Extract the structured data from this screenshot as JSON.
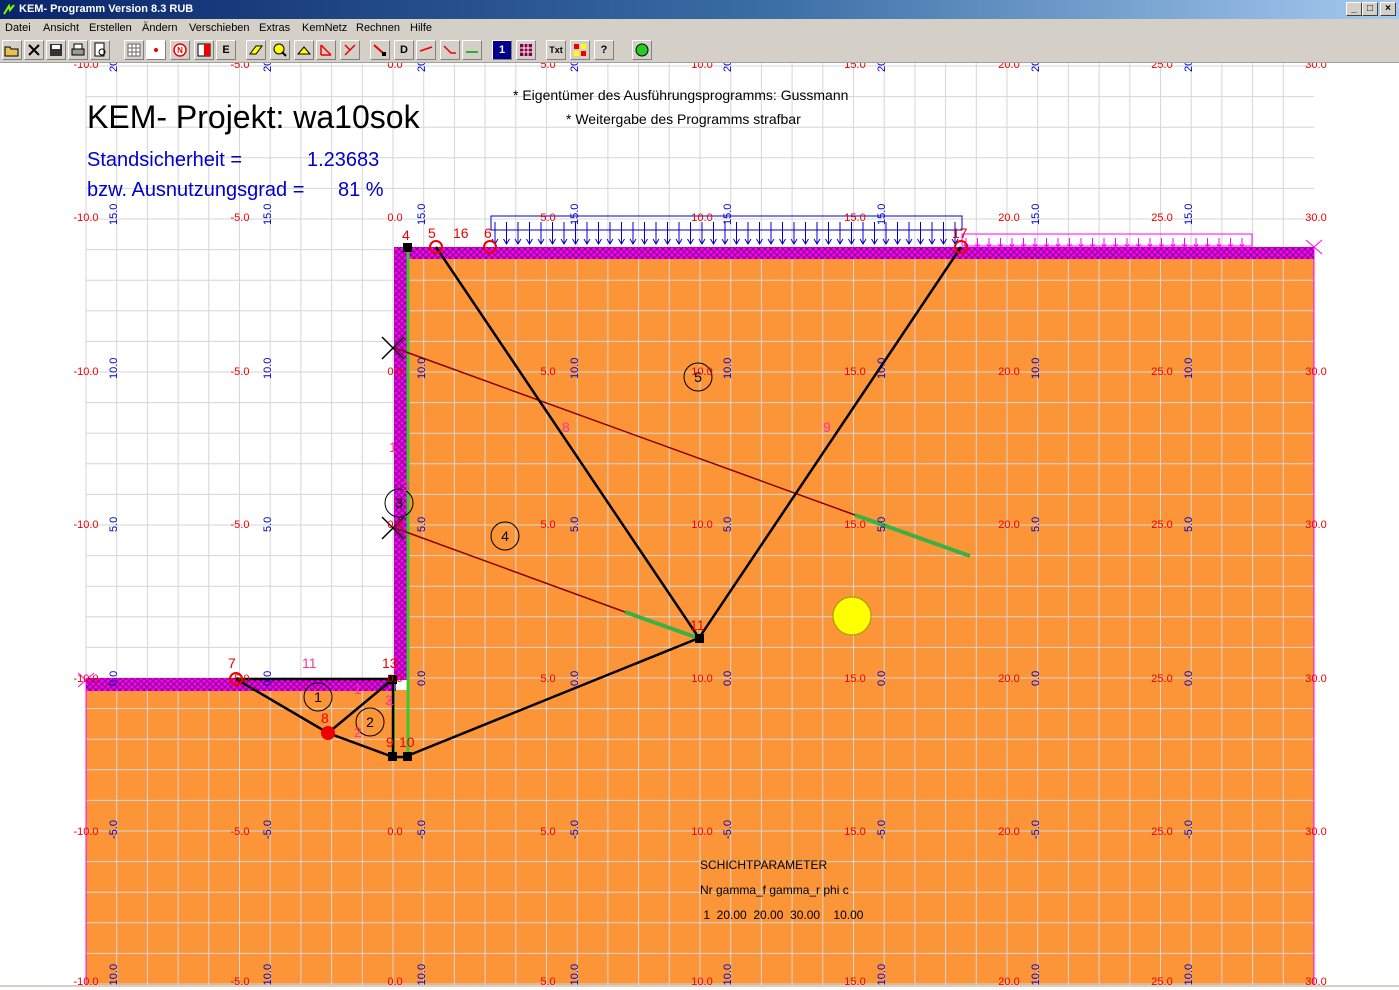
{
  "window": {
    "title": "KEM- Programm Version 8.3 RUB",
    "buttons": {
      "minimize": "_",
      "maximize": "□",
      "close": "×"
    }
  },
  "menu": {
    "items": [
      "Datei",
      "Ansicht",
      "Erstellen",
      "Ändern",
      "Verschieben",
      "Extras",
      "KemNetz",
      "Rechnen",
      "Hilfe"
    ]
  },
  "toolbar": {
    "buttons": [
      {
        "name": "open-icon",
        "label": ""
      },
      {
        "name": "close-file-icon",
        "label": ""
      },
      {
        "name": "save-icon",
        "label": ""
      },
      {
        "name": "print-icon",
        "label": ""
      },
      {
        "name": "print-preview-icon",
        "label": ""
      },
      {
        "name": "grid-icon",
        "label": ""
      },
      {
        "name": "point-icon",
        "label": ""
      },
      {
        "name": "node-icon",
        "label": "N"
      },
      {
        "name": "layer-color-icon",
        "label": ""
      },
      {
        "name": "e-button",
        "label": "E"
      },
      {
        "name": "load-icon",
        "label": ""
      },
      {
        "name": "zoom-icon",
        "label": ""
      },
      {
        "name": "slope-icon",
        "label": ""
      },
      {
        "name": "angle-icon",
        "label": ""
      },
      {
        "name": "diagonal-icon",
        "label": ""
      },
      {
        "name": "arrow-node-icon",
        "label": ""
      },
      {
        "name": "d-node-icon",
        "label": "D"
      },
      {
        "name": "line-icon-1",
        "label": ""
      },
      {
        "name": "line-icon-2",
        "label": ""
      },
      {
        "name": "anchor-icon",
        "label": ""
      },
      {
        "name": "one-icon",
        "label": "1"
      },
      {
        "name": "matrix-icon",
        "label": ""
      },
      {
        "name": "text-icon",
        "label": "Txt"
      },
      {
        "name": "colors-icon",
        "label": ""
      },
      {
        "name": "help-icon",
        "label": "?"
      },
      {
        "name": "run-icon",
        "label": ""
      }
    ]
  },
  "colors": {
    "soil": "#fb9537",
    "grid": "#d6d6d6",
    "magenta": "#ff00ff",
    "hatch": "#cc00cc",
    "red_label": "#e00000",
    "blue_label": "#0000cc",
    "pink_label": "#ff3399",
    "anchor": "#8b0000",
    "anchor_green": "#3cb043",
    "wall_green": "#33cc33",
    "load_blue": "#0000cc",
    "highlight_yellow": "#ffff00"
  },
  "header": {
    "title": "KEM- Projekt: wa10sok",
    "owner_note": "* Eigentümer des Ausführungsprogramms: Gussmann",
    "forbidden_note": "* Weitergabe des Programms strafbar",
    "safety_label": "Standsicherheit =",
    "safety_value": "1.23683",
    "utilization_label": "bzw. Ausnutzungsgrad =",
    "utilization_value": "81 %"
  },
  "axes": {
    "x_labels": [
      "-10.0",
      "-5.0",
      "0.0",
      "5.0",
      "10.0",
      "15.0",
      "20.0",
      "25.0",
      "30.0"
    ],
    "y_labels": [
      "20",
      "15.0",
      "10.0",
      "5.0",
      "0.0",
      "-5.0",
      "-10.0"
    ]
  },
  "nodes": {
    "red_labels": [
      "4",
      "5",
      "16",
      "6",
      "17",
      "7",
      "8",
      "13",
      "9",
      "10",
      "11"
    ],
    "pink_labels": [
      "11",
      "1",
      "2",
      "3",
      "4",
      "1",
      "3",
      "8",
      "9"
    ],
    "elements": [
      "1",
      "2",
      "3",
      "4",
      "5"
    ]
  },
  "soil_table": {
    "title": "SCHICHTPARAMETER",
    "header": "Nr gamma_f gamma_r phi c",
    "row": " 1  20.00  20.00  30.00    10.00"
  }
}
